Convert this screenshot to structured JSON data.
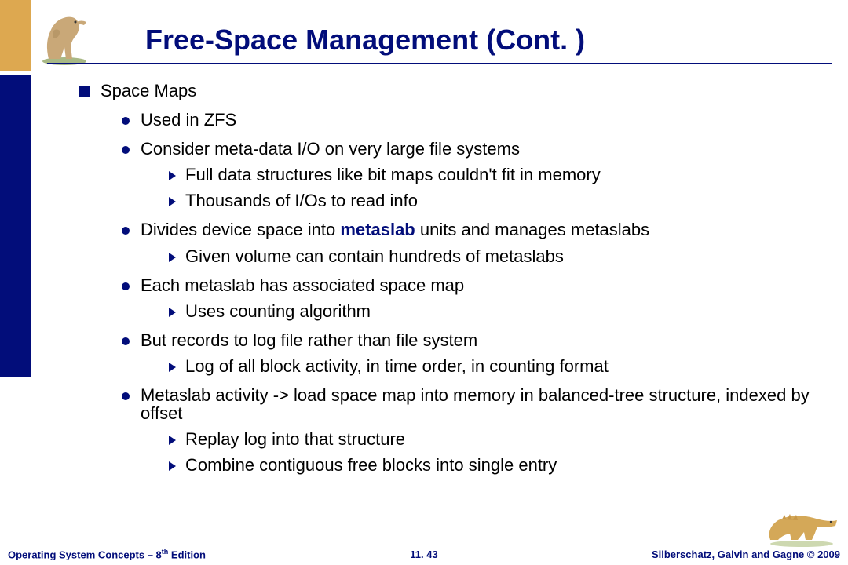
{
  "title": "Free-Space Management (Cont. )",
  "bullets": {
    "l1_1": "Space Maps",
    "l2_1": "Used in ZFS",
    "l2_2": "Consider meta-data I/O on very large file systems",
    "l3_1": "Full data structures like bit maps couldn't fit in memory",
    "l3_2": "Thousands of I/Os to read info",
    "l2_3a": "Divides device space into ",
    "l2_3kw": "metaslab",
    "l2_3b": " units and manages metaslabs",
    "l3_3": "Given volume can contain hundreds of metaslabs",
    "l2_4": "Each metaslab has associated space map",
    "l3_4": "Uses counting algorithm",
    "l2_5": "But records to log file rather than file system",
    "l3_5": "Log of all block activity, in time order, in counting format",
    "l2_6": "Metaslab activity -> load space map into memory in balanced-tree structure, indexed by offset",
    "l3_6": "Replay log into that structure",
    "l3_7": "Combine contiguous free blocks into single entry"
  },
  "footer": {
    "left_a": "Operating System Concepts – 8",
    "left_sup": "th",
    "left_b": " Edition",
    "center": "11. 43",
    "right": "Silberschatz, Galvin and Gagne © 2009"
  }
}
